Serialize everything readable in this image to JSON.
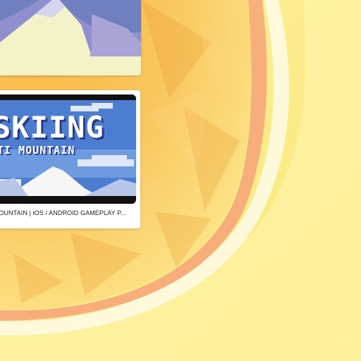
{
  "video_card": {
    "title_big": "SKIING",
    "title_sub": "ETI MOUNTAIN",
    "caption": "TI MOUNTAIN | iOS / ANDROID GAMEPLAY P..."
  },
  "colors": {
    "background_yellow": "#fbe98a",
    "orange_panel": "#f8b84a",
    "pink_ring": "#f5a070"
  }
}
